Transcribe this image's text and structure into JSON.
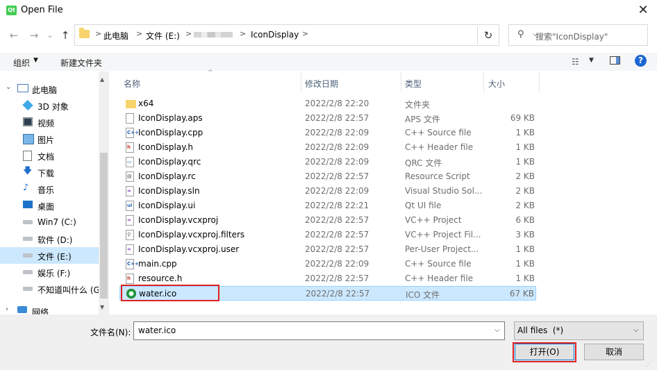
{
  "window": {
    "title": "Open File",
    "logo_text": "Qt",
    "close_glyph": "✕"
  },
  "nav": {
    "back_glyph": "←",
    "forward_glyph": "→",
    "recent_glyph": "⌄",
    "up_glyph": "↑",
    "refresh_glyph": "↻",
    "breadcrumb": [
      "此电脑",
      "文件 (E:)",
      "IconDisplay"
    ],
    "separator": ">",
    "search_placeholder": "搜索\"IconDisplay\""
  },
  "toolbar": {
    "organize_label": "组织",
    "new_folder_label": "新建文件夹",
    "help_glyph": "?"
  },
  "sidebar": {
    "items": [
      {
        "label": "此电脑",
        "icon": "computer-icon"
      },
      {
        "label": "3D 对象",
        "icon": "3d-objects-icon"
      },
      {
        "label": "视频",
        "icon": "video-icon"
      },
      {
        "label": "图片",
        "icon": "pictures-icon"
      },
      {
        "label": "文档",
        "icon": "documents-icon"
      },
      {
        "label": "下载",
        "icon": "download-icon"
      },
      {
        "label": "音乐",
        "icon": "music-icon"
      },
      {
        "label": "桌面",
        "icon": "desktop-icon"
      },
      {
        "label": "Win7 (C:)",
        "icon": "drive-icon"
      },
      {
        "label": "软件 (D:)",
        "icon": "drive-icon"
      },
      {
        "label": "文件 (E:)",
        "icon": "drive-icon",
        "selected": true
      },
      {
        "label": "娱乐 (F:)",
        "icon": "drive-icon"
      },
      {
        "label": "不知道叫什么 (G",
        "icon": "drive-icon"
      },
      {
        "label": "网络",
        "icon": "network-icon"
      }
    ]
  },
  "columns": {
    "name": "名称",
    "date": "修改日期",
    "type": "类型",
    "size": "大小"
  },
  "files": [
    {
      "name": "x64",
      "date": "2022/2/8 22:20",
      "type": "文件夹",
      "size": "",
      "icon": "folder-icon"
    },
    {
      "name": "IconDisplay.aps",
      "date": "2022/2/8 22:57",
      "type": "APS 文件",
      "size": "69 KB",
      "icon": "file-icon"
    },
    {
      "name": "IconDisplay.cpp",
      "date": "2022/2/8 22:09",
      "type": "C++ Source file",
      "size": "1 KB",
      "icon": "cpp-file-icon"
    },
    {
      "name": "IconDisplay.h",
      "date": "2022/2/8 22:09",
      "type": "C++ Header file",
      "size": "1 KB",
      "icon": "header-file-icon"
    },
    {
      "name": "IconDisplay.qrc",
      "date": "2022/2/8 22:09",
      "type": "QRC 文件",
      "size": "1 KB",
      "icon": "qrc-file-icon"
    },
    {
      "name": "IconDisplay.rc",
      "date": "2022/2/8 22:57",
      "type": "Resource Script",
      "size": "2 KB",
      "icon": "rc-file-icon"
    },
    {
      "name": "IconDisplay.sln",
      "date": "2022/2/8 22:09",
      "type": "Visual Studio Sol...",
      "size": "2 KB",
      "icon": "sln-file-icon"
    },
    {
      "name": "IconDisplay.ui",
      "date": "2022/2/8 22:21",
      "type": "Qt UI file",
      "size": "2 KB",
      "icon": "ui-file-icon"
    },
    {
      "name": "IconDisplay.vcxproj",
      "date": "2022/2/8 22:57",
      "type": "VC++ Project",
      "size": "6 KB",
      "icon": "vcxproj-file-icon"
    },
    {
      "name": "IconDisplay.vcxproj.filters",
      "date": "2022/2/8 22:57",
      "type": "VC++ Project Fil...",
      "size": "3 KB",
      "icon": "filters-file-icon"
    },
    {
      "name": "IconDisplay.vcxproj.user",
      "date": "2022/2/8 22:57",
      "type": "Per-User Project...",
      "size": "1 KB",
      "icon": "user-file-icon"
    },
    {
      "name": "main.cpp",
      "date": "2022/2/8 22:09",
      "type": "C++ Source file",
      "size": "1 KB",
      "icon": "cpp-file-icon"
    },
    {
      "name": "resource.h",
      "date": "2022/2/8 22:57",
      "type": "C++ Header file",
      "size": "1 KB",
      "icon": "header-file-icon"
    },
    {
      "name": "water.ico",
      "date": "2022/2/8 22:57",
      "type": "ICO 文件",
      "size": "67 KB",
      "icon": "ico-file-icon",
      "selected": true
    }
  ],
  "footer": {
    "filename_label": "文件名(N):",
    "filename_value": "water.ico",
    "filetype_value": "All files  (*)",
    "open_label": "打开(O)",
    "cancel_label": "取消"
  },
  "colors": {
    "selection": "#cce8ff",
    "highlight_border": "#e02020",
    "accent": "#0078d7"
  }
}
